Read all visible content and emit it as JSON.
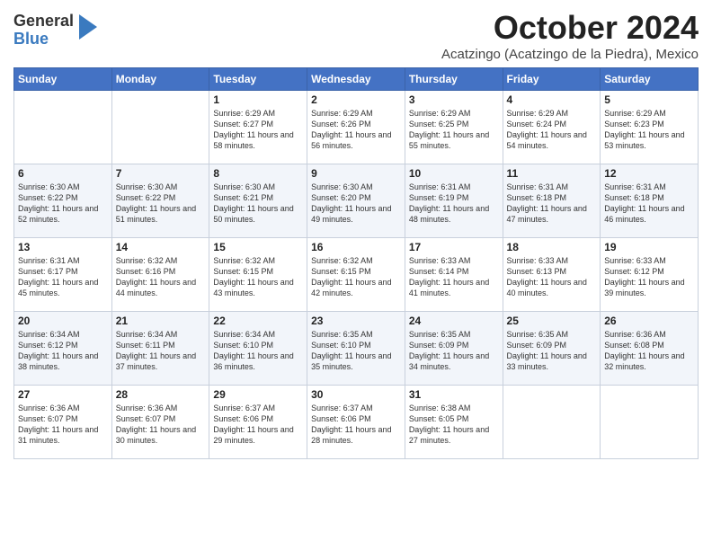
{
  "logo": {
    "general": "General",
    "blue": "Blue"
  },
  "header": {
    "month": "October 2024",
    "subtitle": "Acatzingo (Acatzingo de la Piedra), Mexico"
  },
  "days_of_week": [
    "Sunday",
    "Monday",
    "Tuesday",
    "Wednesday",
    "Thursday",
    "Friday",
    "Saturday"
  ],
  "weeks": [
    [
      {
        "day": "",
        "info": ""
      },
      {
        "day": "",
        "info": ""
      },
      {
        "day": "1",
        "info": "Sunrise: 6:29 AM\nSunset: 6:27 PM\nDaylight: 11 hours and 58 minutes."
      },
      {
        "day": "2",
        "info": "Sunrise: 6:29 AM\nSunset: 6:26 PM\nDaylight: 11 hours and 56 minutes."
      },
      {
        "day": "3",
        "info": "Sunrise: 6:29 AM\nSunset: 6:25 PM\nDaylight: 11 hours and 55 minutes."
      },
      {
        "day": "4",
        "info": "Sunrise: 6:29 AM\nSunset: 6:24 PM\nDaylight: 11 hours and 54 minutes."
      },
      {
        "day": "5",
        "info": "Sunrise: 6:29 AM\nSunset: 6:23 PM\nDaylight: 11 hours and 53 minutes."
      }
    ],
    [
      {
        "day": "6",
        "info": "Sunrise: 6:30 AM\nSunset: 6:22 PM\nDaylight: 11 hours and 52 minutes."
      },
      {
        "day": "7",
        "info": "Sunrise: 6:30 AM\nSunset: 6:22 PM\nDaylight: 11 hours and 51 minutes."
      },
      {
        "day": "8",
        "info": "Sunrise: 6:30 AM\nSunset: 6:21 PM\nDaylight: 11 hours and 50 minutes."
      },
      {
        "day": "9",
        "info": "Sunrise: 6:30 AM\nSunset: 6:20 PM\nDaylight: 11 hours and 49 minutes."
      },
      {
        "day": "10",
        "info": "Sunrise: 6:31 AM\nSunset: 6:19 PM\nDaylight: 11 hours and 48 minutes."
      },
      {
        "day": "11",
        "info": "Sunrise: 6:31 AM\nSunset: 6:18 PM\nDaylight: 11 hours and 47 minutes."
      },
      {
        "day": "12",
        "info": "Sunrise: 6:31 AM\nSunset: 6:18 PM\nDaylight: 11 hours and 46 minutes."
      }
    ],
    [
      {
        "day": "13",
        "info": "Sunrise: 6:31 AM\nSunset: 6:17 PM\nDaylight: 11 hours and 45 minutes."
      },
      {
        "day": "14",
        "info": "Sunrise: 6:32 AM\nSunset: 6:16 PM\nDaylight: 11 hours and 44 minutes."
      },
      {
        "day": "15",
        "info": "Sunrise: 6:32 AM\nSunset: 6:15 PM\nDaylight: 11 hours and 43 minutes."
      },
      {
        "day": "16",
        "info": "Sunrise: 6:32 AM\nSunset: 6:15 PM\nDaylight: 11 hours and 42 minutes."
      },
      {
        "day": "17",
        "info": "Sunrise: 6:33 AM\nSunset: 6:14 PM\nDaylight: 11 hours and 41 minutes."
      },
      {
        "day": "18",
        "info": "Sunrise: 6:33 AM\nSunset: 6:13 PM\nDaylight: 11 hours and 40 minutes."
      },
      {
        "day": "19",
        "info": "Sunrise: 6:33 AM\nSunset: 6:12 PM\nDaylight: 11 hours and 39 minutes."
      }
    ],
    [
      {
        "day": "20",
        "info": "Sunrise: 6:34 AM\nSunset: 6:12 PM\nDaylight: 11 hours and 38 minutes."
      },
      {
        "day": "21",
        "info": "Sunrise: 6:34 AM\nSunset: 6:11 PM\nDaylight: 11 hours and 37 minutes."
      },
      {
        "day": "22",
        "info": "Sunrise: 6:34 AM\nSunset: 6:10 PM\nDaylight: 11 hours and 36 minutes."
      },
      {
        "day": "23",
        "info": "Sunrise: 6:35 AM\nSunset: 6:10 PM\nDaylight: 11 hours and 35 minutes."
      },
      {
        "day": "24",
        "info": "Sunrise: 6:35 AM\nSunset: 6:09 PM\nDaylight: 11 hours and 34 minutes."
      },
      {
        "day": "25",
        "info": "Sunrise: 6:35 AM\nSunset: 6:09 PM\nDaylight: 11 hours and 33 minutes."
      },
      {
        "day": "26",
        "info": "Sunrise: 6:36 AM\nSunset: 6:08 PM\nDaylight: 11 hours and 32 minutes."
      }
    ],
    [
      {
        "day": "27",
        "info": "Sunrise: 6:36 AM\nSunset: 6:07 PM\nDaylight: 11 hours and 31 minutes."
      },
      {
        "day": "28",
        "info": "Sunrise: 6:36 AM\nSunset: 6:07 PM\nDaylight: 11 hours and 30 minutes."
      },
      {
        "day": "29",
        "info": "Sunrise: 6:37 AM\nSunset: 6:06 PM\nDaylight: 11 hours and 29 minutes."
      },
      {
        "day": "30",
        "info": "Sunrise: 6:37 AM\nSunset: 6:06 PM\nDaylight: 11 hours and 28 minutes."
      },
      {
        "day": "31",
        "info": "Sunrise: 6:38 AM\nSunset: 6:05 PM\nDaylight: 11 hours and 27 minutes."
      },
      {
        "day": "",
        "info": ""
      },
      {
        "day": "",
        "info": ""
      }
    ]
  ]
}
